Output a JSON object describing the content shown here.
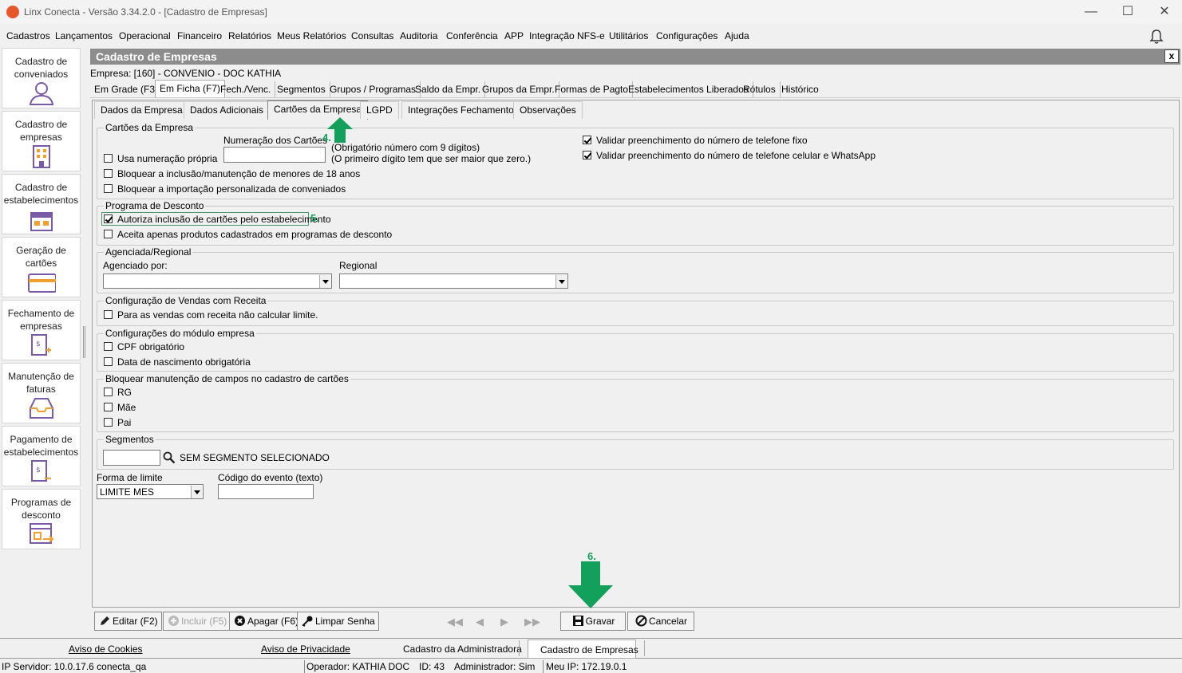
{
  "window": {
    "title": "Linx Conecta - Versão 3.34.2.0 - [Cadastro de Empresas]",
    "minimize": "—",
    "maximize": "☐",
    "close": "✕"
  },
  "menu": [
    "Cadastros",
    "Lançamentos",
    "Operacional",
    "Financeiro",
    "Relatórios",
    "Meus Relatórios",
    "Consultas",
    "Auditoria",
    "Conferência",
    "APP",
    "Integração NFS-e",
    "Utilitários",
    "Configurações",
    "Ajuda"
  ],
  "sidebar": [
    {
      "label": "Cadastro de conveniados",
      "icon": "user-icon"
    },
    {
      "label": "Cadastro de empresas",
      "icon": "building-icon"
    },
    {
      "label": "Cadastro de estabelecimentos",
      "icon": "store-icon"
    },
    {
      "label": "Geração de cartões",
      "icon": "card-icon"
    },
    {
      "label": "Fechamento de empresas",
      "icon": "invoice-add-icon"
    },
    {
      "label": "Manutenção de faturas",
      "icon": "inbox-icon"
    },
    {
      "label": "Pagamento de estabelecimentos",
      "icon": "payment-doc-icon"
    },
    {
      "label": "Programas de desconto",
      "icon": "program-icon"
    }
  ],
  "header": {
    "title": "Cadastro de Empresas",
    "close": "x"
  },
  "empresa": "Empresa: [160] - CONVENIO -  DOC KATHIA",
  "tabs1": [
    "Em Grade (F3)",
    "Em Ficha (F7)",
    "Fech./Venc.",
    "Segmentos",
    "Grupos / Programas",
    "Saldo da Empr.",
    "Grupos da Empr.",
    "Formas de Pagto",
    "Estabelecimentos Liberados",
    "Rótulos",
    "Histórico"
  ],
  "tabs2": [
    "Dados da Empresa",
    "Dados Adicionais",
    "Cartões da Empresa",
    "LGPD",
    "Integrações Fechamento",
    "Observações"
  ],
  "cartoes": {
    "group": "Cartões da Empresa",
    "usa_numeracao": "Usa numeração própria",
    "numeracao_label": "Numeração dos Cartões",
    "numeracao_value": "",
    "hint1": "(Obrigatório número com 9 dígitos)",
    "hint2": "(O primeiro dígito tem que ser maior que zero.)",
    "bloquear_menores": "Bloquear a inclusão/manutenção de menores de 18 anos",
    "bloquear_importacao": "Bloquear a importação personalizada de conveniados",
    "validar_fixo": "Validar preenchimento do número de telefone fixo",
    "validar_celular": "Validar preenchimento do número de telefone celular e WhatsApp"
  },
  "desconto": {
    "group": "Programa de Desconto",
    "autoriza": "Autoriza inclusão de cartões pelo estabelecimento",
    "aceita": "Aceita apenas produtos cadastrados em programas de desconto"
  },
  "agenciada": {
    "group": "Agenciada/Regional",
    "agenciado_label": "Agenciado por:",
    "agenciado_value": "",
    "regional_label": "Regional",
    "regional_value": ""
  },
  "receita": {
    "group": "Configuração de Vendas com Receita",
    "opt": "Para as vendas com receita não calcular limite."
  },
  "modulo": {
    "group": "Configurações do módulo empresa",
    "cpf": "CPF obrigatório",
    "nascimento": "Data de nascimento obrigatória"
  },
  "bloquear": {
    "group": "Bloquear manutenção de campos no cadastro de cartões",
    "rg": "RG",
    "mae": "Mãe",
    "pai": "Pai"
  },
  "segmentos": {
    "group": "Segmentos",
    "value": "",
    "status": "SEM SEGMENTO SELECIONADO"
  },
  "forma_limite": {
    "label": "Forma de limite",
    "value": "LIMITE MES"
  },
  "codigo_evento": {
    "label": "Código do evento (texto)",
    "value": ""
  },
  "annotations": {
    "a4": "4.",
    "a5": "5.",
    "a6": "6."
  },
  "buttons": {
    "editar": "Editar (F2)",
    "incluir": "Incluir (F5)",
    "apagar": "Apagar (F6)",
    "limpar": "Limpar Senha",
    "gravar": "Gravar",
    "cancelar": "Cancelar"
  },
  "nav": {
    "first": "◀◀",
    "prev": "◀",
    "next": "▶",
    "last": "▶▶"
  },
  "footer": [
    "Aviso de Cookies",
    "Aviso de Privacidade",
    "Cadastro da Administradora",
    "Cadastro de Empresas"
  ],
  "status": {
    "servidor": "IP Servidor: 10.0.17.6 conecta_qa",
    "operador": "Operador: KATHIA DOC",
    "id": "ID: 43",
    "admin": "Administrador: Sim",
    "ip": "Meu IP: 172.19.0.1"
  },
  "colors": {
    "accent_green": "#13a05b",
    "header_gray": "#8c8c8c",
    "icon_purple": "#7a5aa6",
    "icon_orange": "#f0a030"
  }
}
